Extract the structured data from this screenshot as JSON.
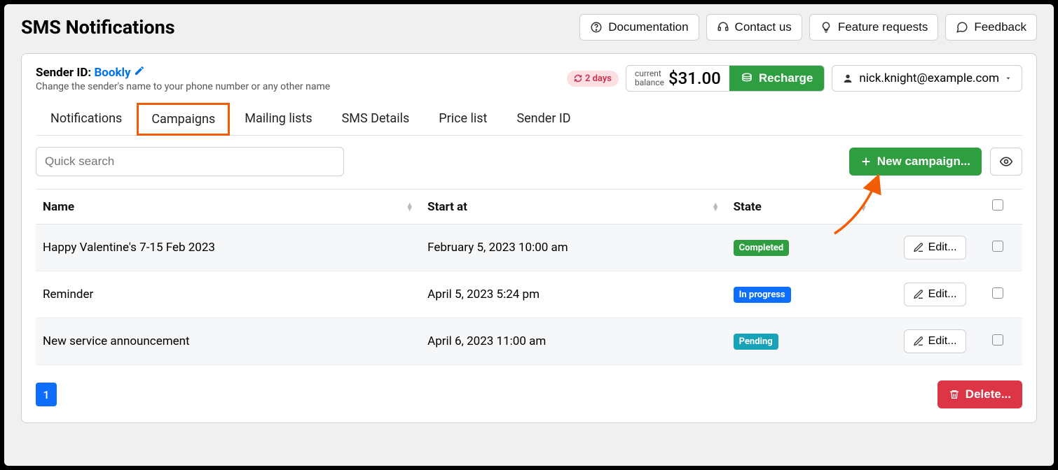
{
  "page_title": "SMS Notifications",
  "top_buttons": {
    "documentation": "Documentation",
    "contact": "Contact us",
    "feature": "Feature requests",
    "feedback": "Feedback"
  },
  "sender": {
    "label": "Sender ID:",
    "value": "Bookly",
    "desc": "Change the sender's name to your phone number or any other name"
  },
  "days_badge": "2 days",
  "balance": {
    "label_line1": "current",
    "label_line2": "balance",
    "amount": "$31.00",
    "recharge": "Recharge"
  },
  "user_email": "nick.knight@example.com",
  "tabs": [
    "Notifications",
    "Campaigns",
    "Mailing lists",
    "SMS Details",
    "Price list",
    "Sender ID"
  ],
  "active_tab_index": 1,
  "search_placeholder": "Quick search",
  "new_campaign": "New campaign...",
  "columns": {
    "name": "Name",
    "start": "Start at",
    "state": "State"
  },
  "rows": [
    {
      "name": "Happy Valentine's 7-15 Feb 2023",
      "start": "February 5, 2023 10:00 am",
      "state": "Completed",
      "state_class": "completed"
    },
    {
      "name": "Reminder",
      "start": "April 5, 2023 5:24 pm",
      "state": "In progress",
      "state_class": "inprogress"
    },
    {
      "name": "New service announcement",
      "start": "April 6, 2023 11:00 am",
      "state": "Pending",
      "state_class": "pending"
    }
  ],
  "edit_label": "Edit...",
  "page_number": "1",
  "delete_label": "Delete..."
}
